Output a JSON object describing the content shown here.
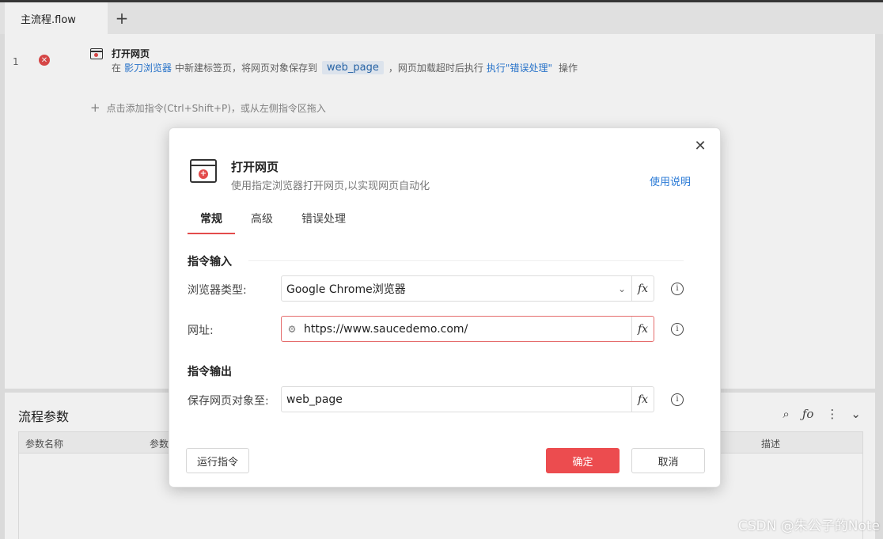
{
  "tabs": [
    {
      "label": "主流程.flow"
    }
  ],
  "tab_add": "+",
  "editor": {
    "line_number": "1",
    "step": {
      "title": "打开网页",
      "desc_prefix": "在",
      "browser_link": "影刀浏览器",
      "desc_mid": "中新建标签页，将网页对象保存到",
      "var_chip": "web_page",
      "desc_mid2": "，网页加载超时后执行",
      "action_link": "执行\"错误处理\"",
      "desc_suffix": "操作"
    },
    "add_hint": "点击添加指令(Ctrl+Shift+P)，或从左侧指令区拖入"
  },
  "params_panel": {
    "title": "流程参数",
    "columns": [
      "参数名称",
      "参数",
      "描述"
    ]
  },
  "dialog": {
    "title": "打开网页",
    "subtitle": "使用指定浏览器打开网页,以实现网页自动化",
    "help_link": "使用说明",
    "tabs": [
      "常规",
      "高级",
      "错误处理"
    ],
    "active_tab": "常规",
    "input_section": "指令输入",
    "output_section": "指令输出",
    "fields": {
      "browser_type": {
        "label": "浏览器类型:",
        "value": "Google Chrome浏览器"
      },
      "url": {
        "label": "网址:",
        "value": "https://www.saucedemo.com/"
      },
      "save_to": {
        "label": "保存网页对象至:",
        "value": "web_page"
      }
    },
    "buttons": {
      "run": "运行指令",
      "ok": "确定",
      "cancel": "取消"
    }
  },
  "watermark": "CSDN @朱公子的Note",
  "colors": {
    "accent_red": "#ec4c4f",
    "link_blue": "#2a7ad6"
  }
}
